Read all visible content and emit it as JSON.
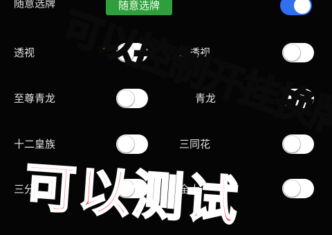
{
  "items": [
    {
      "label": "随意选牌",
      "on": false
    },
    {
      "label": "透视",
      "on": false
    },
    {
      "label": "至尊青龙",
      "on": false
    },
    {
      "label": "十二皇族",
      "on": false
    },
    {
      "label": "三分",
      "on": false
    }
  ],
  "right_items": [
    {
      "label": "",
      "on": true
    },
    {
      "label": "防透视",
      "on": false
    },
    {
      "label": "青龙",
      "on": false
    },
    {
      "label": "三同花",
      "on": false
    },
    {
      "label": "全大",
      "on": false
    }
  ],
  "select_button": "随意选牌",
  "overlay": {
    "line1": "可以控制开挂换牌",
    "line2": "可以测试"
  },
  "colors": {
    "accent": "#2f6ff0",
    "button": "#2f9e3c",
    "overlay_yellow": "#ffde1a",
    "overlay_red": "#ff2437"
  }
}
